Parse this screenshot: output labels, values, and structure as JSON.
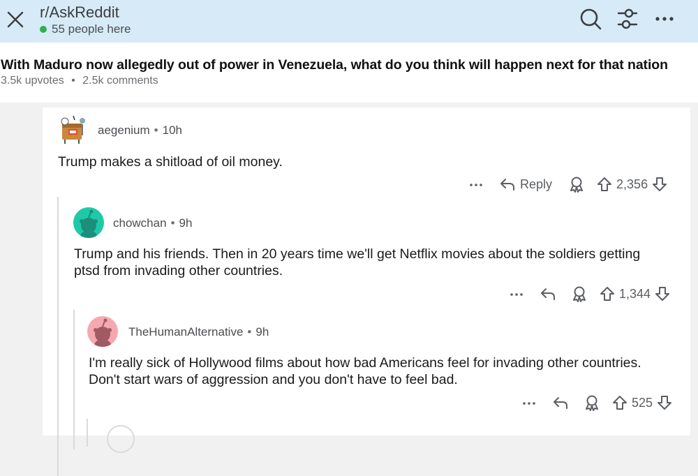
{
  "header": {
    "subreddit": "r/AskReddit",
    "online_count": "55 people here"
  },
  "post": {
    "title": "With Maduro now allegedly out of power in Venezuela, what do you think will happen next for that nation",
    "upvotes": "3.5k upvotes",
    "separator": "•",
    "comments": "2.5k comments"
  },
  "comments": [
    {
      "username": "aegenium",
      "time": "10h",
      "body": "Trump makes a shitload of oil money.",
      "reply_label": "Reply",
      "score": "2,356"
    },
    {
      "username": "chowchan",
      "time": "9h",
      "body": "Trump and his friends. Then in 20 years time we'll get Netflix movies about the soldiers getting ptsd from invading other countries.",
      "score": "1,344"
    },
    {
      "username": "TheHumanAlternative",
      "time": "9h",
      "body": "I'm really sick of Hollywood films about how bad Americans feel for invading other countries. Don't start wars of aggression and you don't have to feel bad.",
      "score": "525"
    }
  ],
  "icons": {
    "close": "close-icon",
    "search": "search-icon",
    "filter": "filter-icon",
    "more": "more-icon",
    "reply": "reply-arrow-icon",
    "award": "award-icon",
    "upvote": "upvote-icon",
    "downvote": "downvote-icon"
  },
  "colors": {
    "header_bg": "#d7eaf8",
    "online_dot": "#2bb24c",
    "avatar_teal": "#1fc9a8",
    "avatar_pink": "#f5a8b0"
  }
}
